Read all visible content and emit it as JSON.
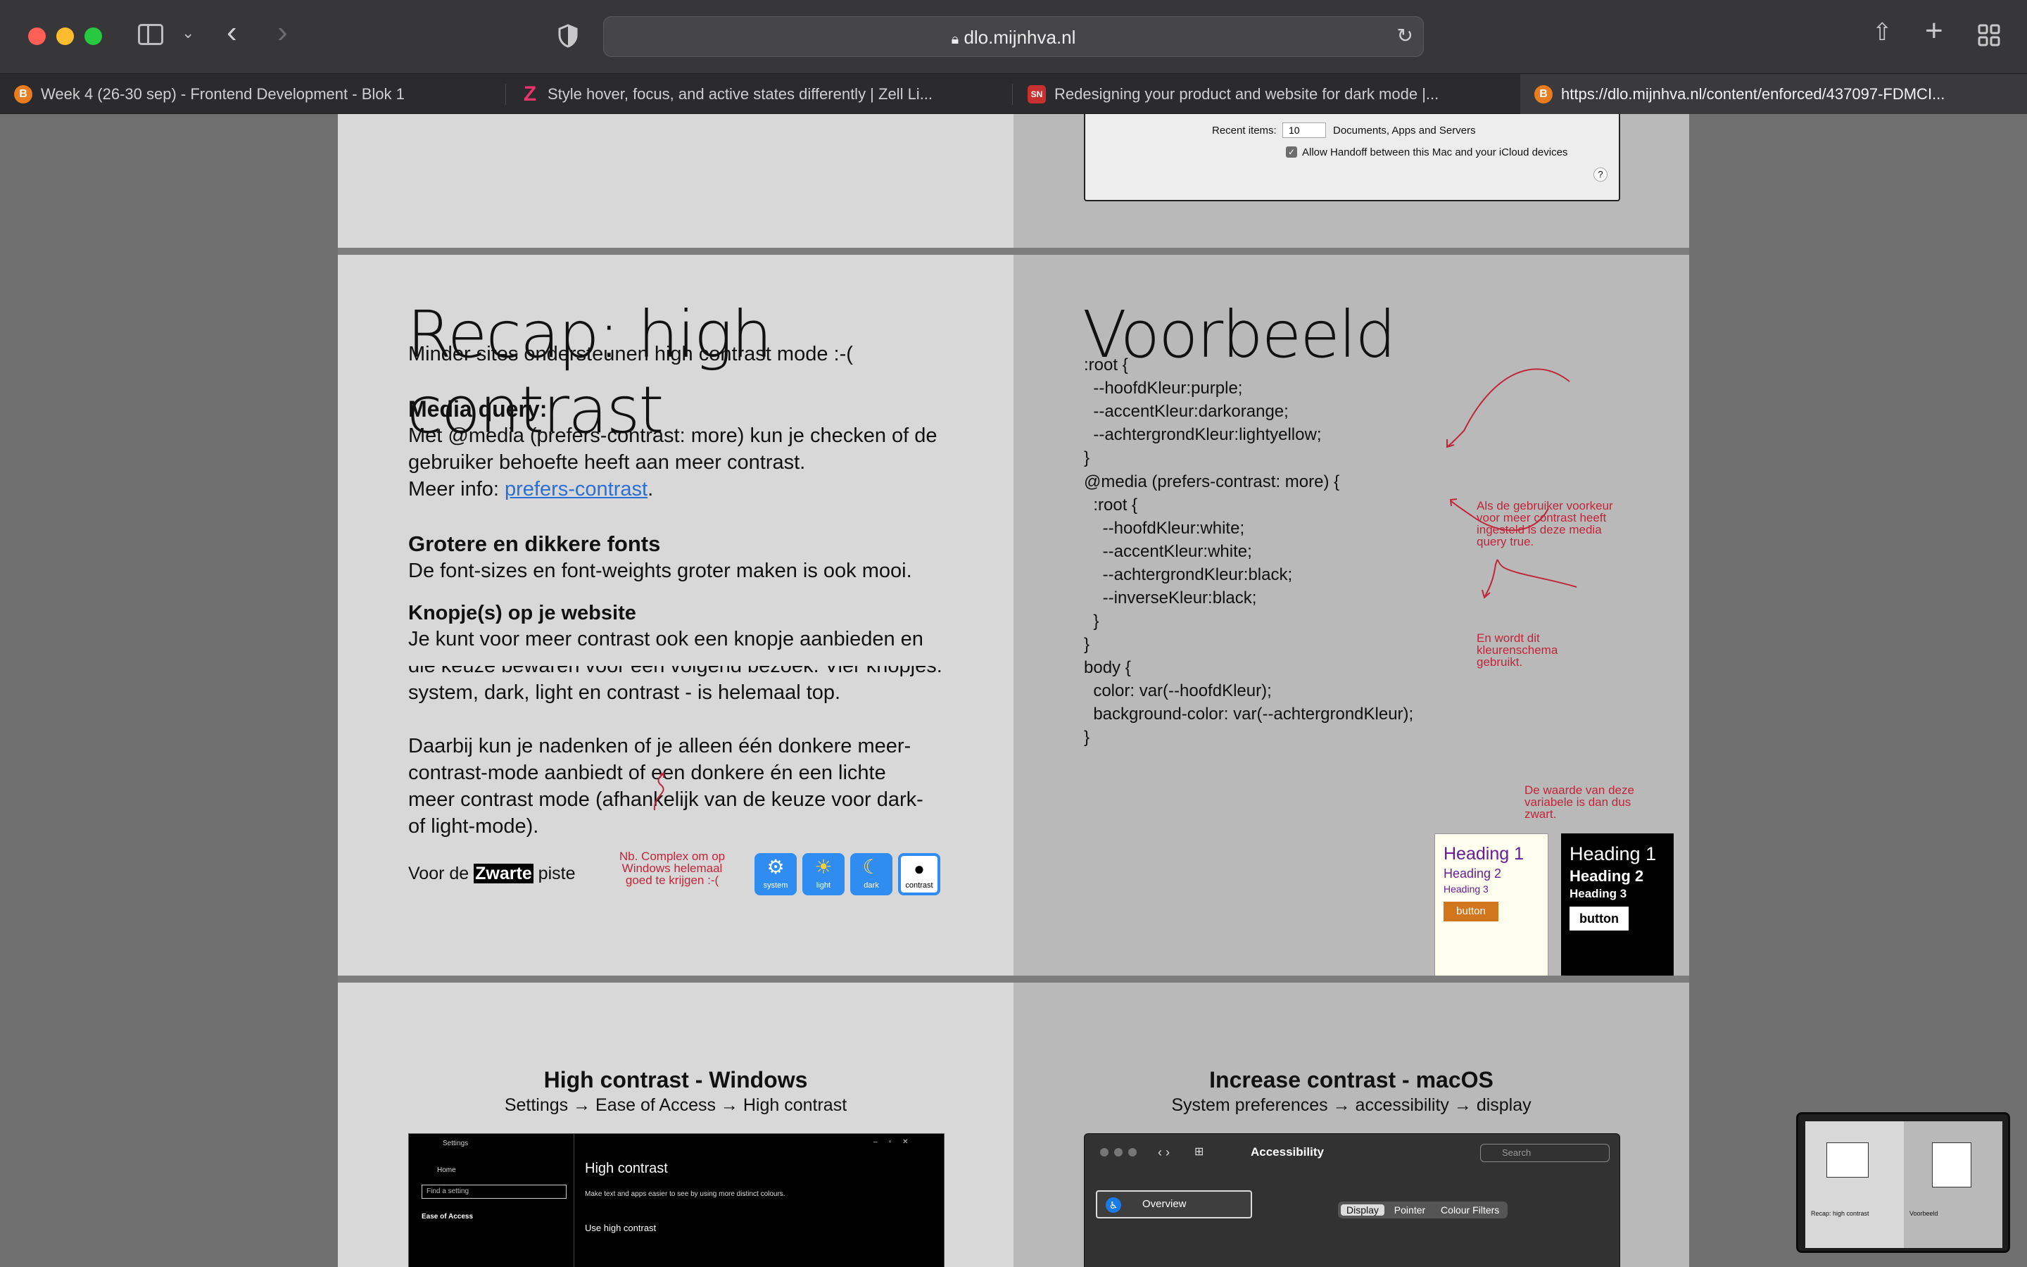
{
  "browser": {
    "url": "dlo.mijnhva.nl",
    "tabs": [
      {
        "title": "Week 4 (26-30 sep) - Frontend Development - Blok 1",
        "favicon": "B"
      },
      {
        "title": "Style hover, focus, and active states differently | Zell Li...",
        "favicon": "Z"
      },
      {
        "title": "Redesigning your product and website for dark mode  |...",
        "favicon": "SN"
      },
      {
        "title": "https://dlo.mijnhva.nl/content/enforced/437097-FDMCI...",
        "favicon": "B"
      }
    ]
  },
  "top_slide": {
    "recent_items_label": "Recent items:",
    "recent_items_value": "10",
    "recent_items_suffix": "Documents, Apps and Servers",
    "handoff_label": "Allow Handoff between this Mac and your iCloud devices",
    "help": "?"
  },
  "recap": {
    "title": "Recap: high contrast",
    "intro": "Minder sites ondersteunen high contrast mode :-(",
    "media_heading": "Media query:",
    "media_line1": "Met @media (prefers-contrast: more) kun je checken of de",
    "media_line2": "gebruiker behoefte heeft aan meer contrast.",
    "more_info": "Meer info: ",
    "more_info_link": "prefers-contrast",
    "more_info_end": ".",
    "fonts_heading": "Grotere en dikkere fonts",
    "fonts_text": "De font-sizes en font-weights groter maken is ook mooi.",
    "buttons_heading": "Knopje(s) op je website",
    "buttons_line1": "Je kunt voor meer contrast ook een knopje aanbieden en",
    "buttons_line2": "die keuze bewaren voor een volgend bezoek. Vier knopjes:",
    "buttons_line3": "system, dark, light en contrast - is helemaal top.",
    "think_line1": "Daarbij kun je nadenken of je alleen één donkere meer-",
    "think_line2": "contrast-mode aanbiedt of een donkere én een lichte",
    "think_line3": "meer contrast mode (afhankelijk van de keuze voor dark-",
    "think_line4": "of light-mode).",
    "black_prefix": "Voor de ",
    "black_word": "Zwarte",
    "black_suffix": " piste",
    "note_line1": "Nb. Complex om op",
    "note_line2": "Windows helemaal",
    "note_line3": "goed te krijgen :-(",
    "mode_buttons": [
      "system",
      "light",
      "dark",
      "contrast"
    ]
  },
  "example": {
    "title": "Voorbeeld",
    "code1": [
      ":root {",
      "  --hoofdKleur:purple;",
      "  --accentKleur:darkorange;",
      "  --achtergrondKleur:lightyellow;",
      "}"
    ],
    "code2": [
      "@media (prefers-contrast: more) {",
      "  :root {",
      "    --hoofdKleur:white;",
      "    --accentKleur:white;",
      "    --achtergrondKleur:black;",
      "    --inverseKleur:black;",
      "  }",
      "}"
    ],
    "code3": [
      "body {",
      "  color: var(--hoofdKleur);",
      "  background-color: var(--achtergrondKleur);",
      "}"
    ],
    "note1": [
      "Als de gebruiker voorkeur",
      "voor meer contrast heeft",
      "ingesteld is deze media",
      "query true."
    ],
    "note2": [
      "En wordt dit",
      "kleurenschema",
      "gebruikt."
    ],
    "note3": [
      "De waarde van deze",
      "variabele is dan dus",
      "zwart."
    ],
    "light_demo": {
      "h1": "Heading 1",
      "h2": "Heading 2",
      "h3": "Heading 3",
      "button": "button"
    },
    "dark_demo": {
      "h1": "Heading 1",
      "h2": "Heading 2",
      "h3": "Heading 3",
      "button": "button"
    }
  },
  "windows_slide": {
    "title": "High contrast - Windows",
    "subtitle": "Settings → Ease of Access → High contrast",
    "settings_label": "Settings",
    "home": "Home",
    "find": "Find a setting",
    "ease": "Ease of Access",
    "heading": "High contrast",
    "desc": "Make text and apps easier to see by using more distinct colours.",
    "use": "Use high contrast"
  },
  "mac_slide": {
    "title": "Increase contrast - macOS",
    "subtitle": "System preferences → accessibility  → display",
    "window_title": "Accessibility",
    "search": "Search",
    "overview": "Overview",
    "tabs": [
      "Display",
      "Pointer",
      "Colour Filters"
    ]
  },
  "thumbnail": {
    "left_label": "Recap: high contrast",
    "right_label": "Voorbeeld"
  }
}
